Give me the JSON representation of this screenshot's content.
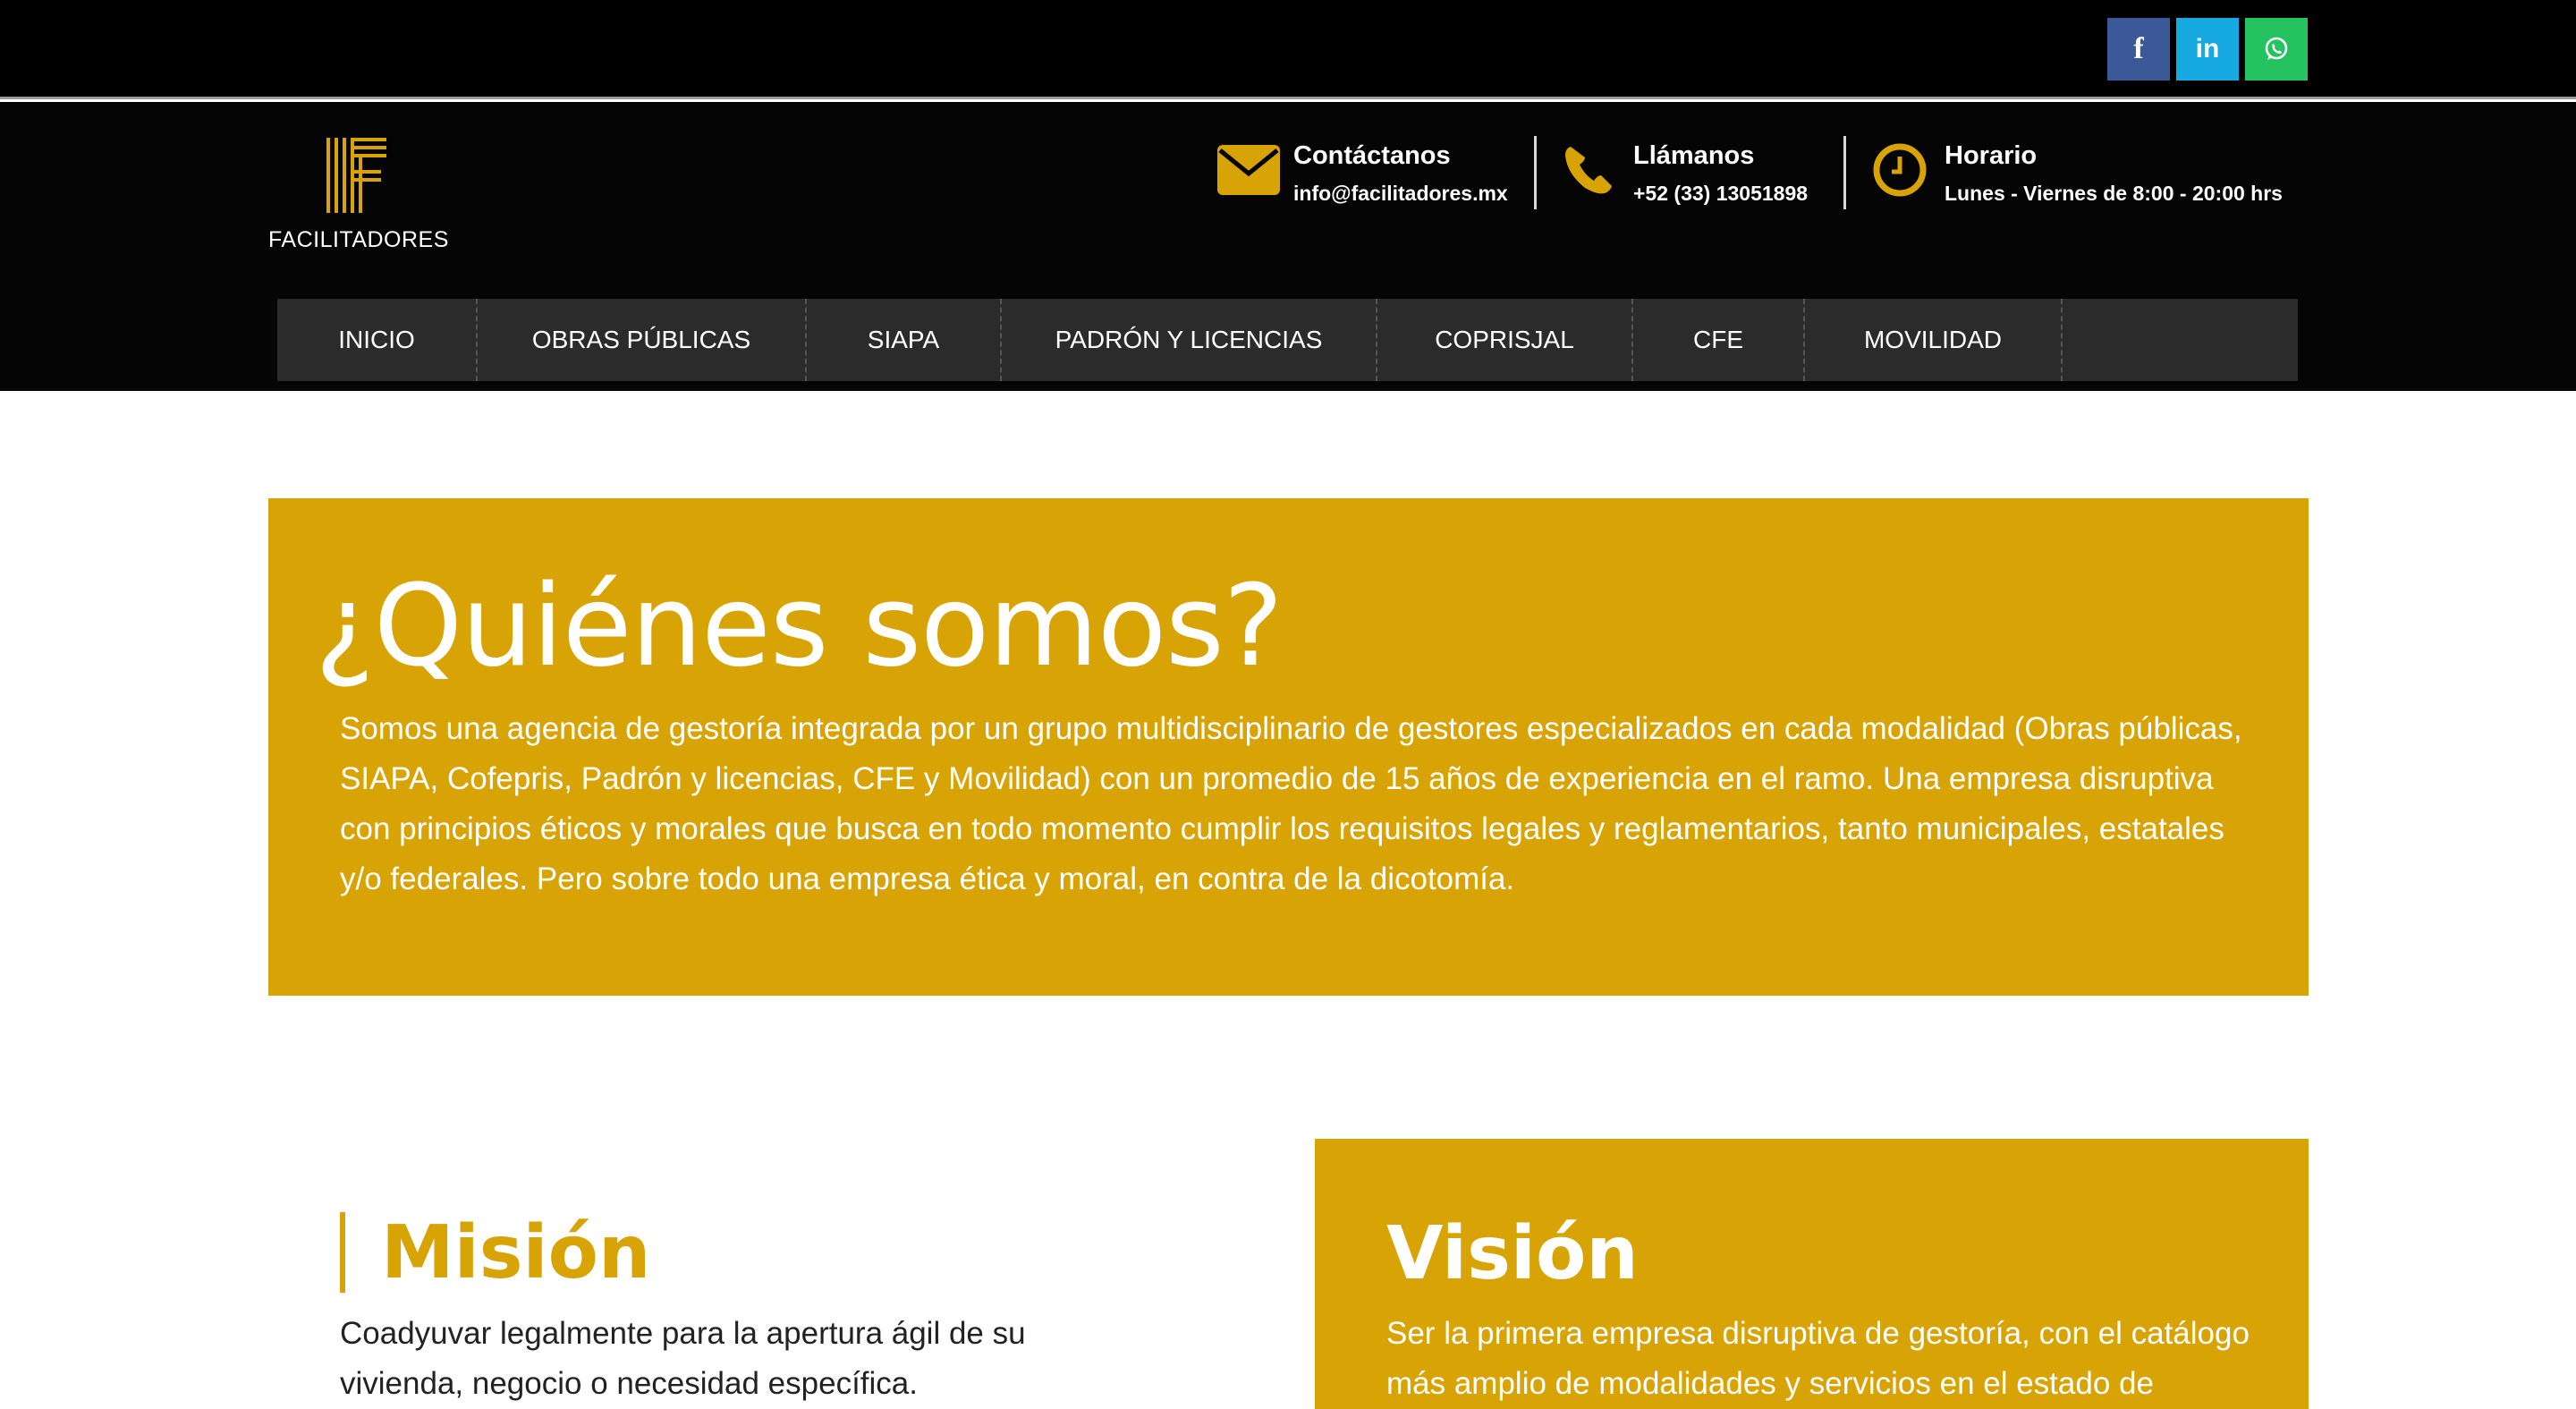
{
  "colors": {
    "accent": "#d8a305",
    "header_bg": "#050505",
    "nav_bg": "#2b2b2b",
    "facebook": "#3b5998",
    "linkedin": "#17a9e2",
    "whatsapp": "#25c35f"
  },
  "social": [
    {
      "name": "facebook",
      "icon": "facebook-icon",
      "glyph": "f"
    },
    {
      "name": "linkedin",
      "icon": "linkedin-icon",
      "glyph": "in"
    },
    {
      "name": "whatsapp",
      "icon": "whatsapp-icon"
    }
  ],
  "brand": {
    "name": "FACILITADORES"
  },
  "contact": {
    "email": {
      "title": "Contáctanos",
      "value": "info@facilitadores.mx",
      "icon": "envelope-icon"
    },
    "phone": {
      "title": "Llámanos",
      "value": "+52 (33) 13051898",
      "icon": "phone-icon"
    },
    "hours": {
      "title": "Horario",
      "value": "Lunes - Viernes de 8:00 - 20:00 hrs",
      "icon": "clock-icon"
    }
  },
  "nav": {
    "items": [
      "INICIO",
      "OBRAS PÚBLICAS",
      "SIAPA",
      "PADRÓN Y LICENCIAS",
      "COPRISJAL",
      "CFE",
      "MOVILIDAD"
    ]
  },
  "about": {
    "title": "¿Quiénes somos?",
    "text": "Somos una agencia de gestoría integrada por un grupo multidisciplinario de gestores especializados en cada modalidad (Obras públicas, SIAPA, Cofepris, Padrón y licencias, CFE y Movilidad) con un promedio de 15 años de experiencia en el ramo. Una empresa disruptiva con principios éticos y morales que busca en todo momento cumplir los requisitos legales y reglamentarios, tanto municipales, estatales y/o federales. Pero sobre todo una empresa ética y moral, en contra de la dicotomía."
  },
  "mision": {
    "title": "Misión",
    "text": "Coadyuvar legalmente para la apertura ágil de su vivienda, negocio o necesidad específica."
  },
  "vision": {
    "title": "Visión",
    "text": "Ser la primera empresa disruptiva de gestoría, con el catálogo más amplio de modalidades y servicios en el estado de"
  }
}
